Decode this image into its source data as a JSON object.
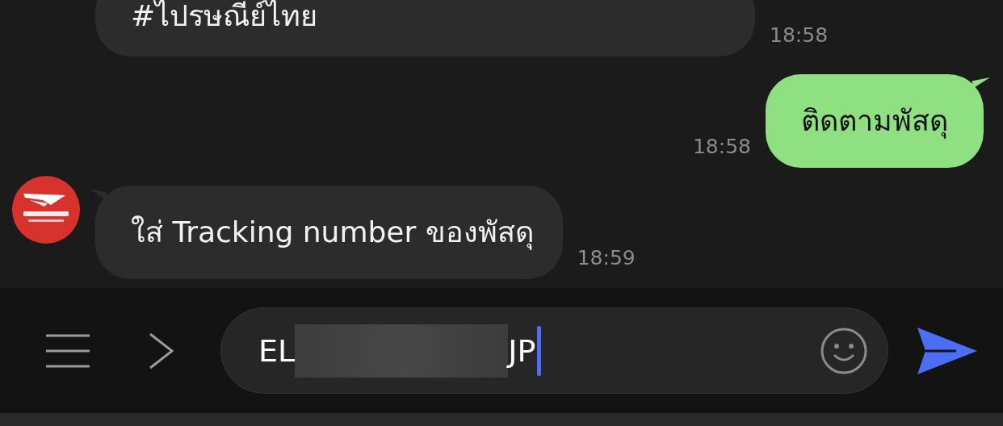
{
  "messages": [
    {
      "kind": "incoming",
      "text": "#ไปรษณีย์ไทย",
      "time": "18:58"
    },
    {
      "kind": "outgoing",
      "text": "ติดตามพัสดุ",
      "time": "18:58"
    },
    {
      "kind": "incoming",
      "avatar": true,
      "text": "ใส่ Tracking number ของพัสดุ",
      "time": "18:59"
    }
  ],
  "composer": {
    "value_start": "EL",
    "redacted": true,
    "value_end": "JP"
  }
}
